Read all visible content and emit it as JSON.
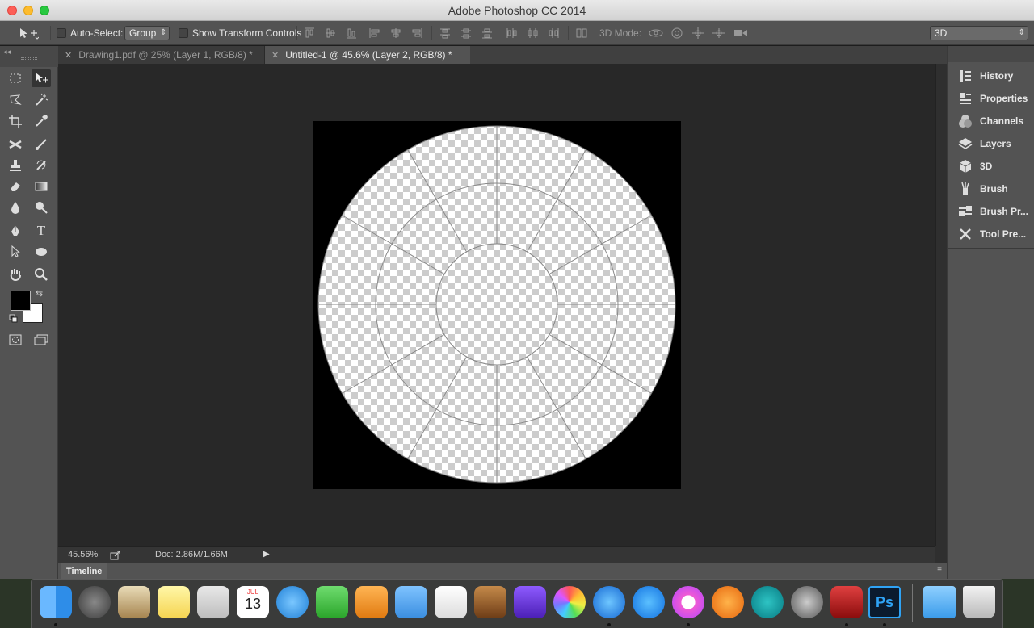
{
  "window": {
    "title": "Adobe Photoshop CC 2014"
  },
  "options_bar": {
    "auto_select_label": "Auto-Select:",
    "auto_select_value": "Group",
    "show_transform_label": "Show Transform Controls",
    "mode_label": "3D Mode:",
    "workspace_value": "3D"
  },
  "tabs": [
    {
      "label": "Drawing1.pdf @ 25% (Layer 1, RGB/8) *",
      "active": false
    },
    {
      "label": "Untitled-1 @ 45.6% (Layer 2, RGB/8) *",
      "active": true
    }
  ],
  "status": {
    "zoom": "45.56%",
    "doc": "Doc: 2.86M/1.66M"
  },
  "timeline": {
    "label": "Timeline"
  },
  "panels": [
    {
      "label": "History",
      "icon": "history-icon"
    },
    {
      "label": "Properties",
      "icon": "properties-icon"
    },
    {
      "label": "Channels",
      "icon": "channels-icon"
    },
    {
      "label": "Layers",
      "icon": "layers-icon"
    },
    {
      "label": "3D",
      "icon": "3d-icon"
    },
    {
      "label": "Brush",
      "icon": "brush-icon"
    },
    {
      "label": "Brush Pr...",
      "icon": "brush-presets-icon"
    },
    {
      "label": "Tool Pre...",
      "icon": "tool-presets-icon"
    }
  ],
  "tools_text": {
    "type_tool": "T"
  },
  "dock_text": {
    "calendar_month": "JUL",
    "calendar_day": "13",
    "photoshop": "Ps"
  },
  "colors": {
    "foreground": "#000000",
    "background": "#ffffff",
    "accent": "#3a6fd8"
  }
}
